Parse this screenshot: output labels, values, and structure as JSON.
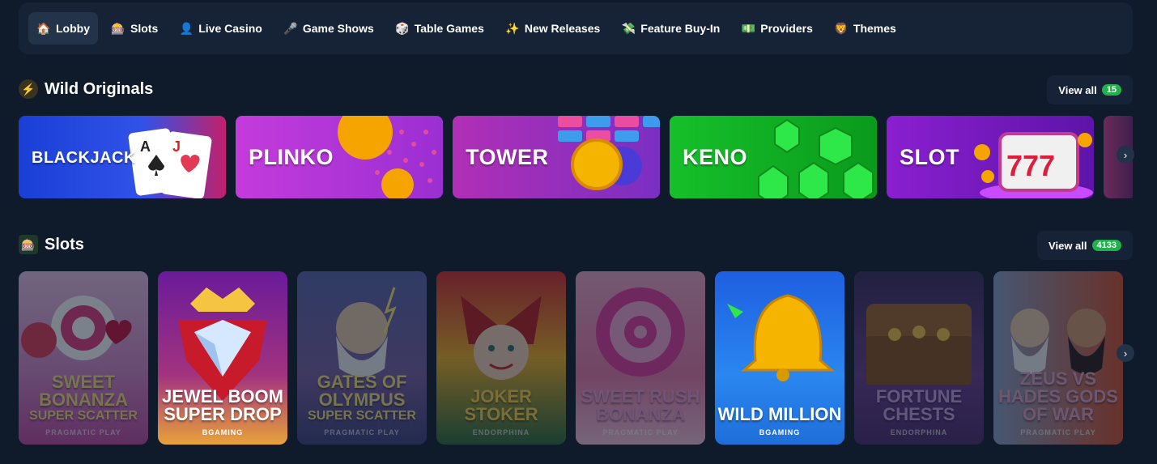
{
  "nav": {
    "items": [
      {
        "label": "Lobby",
        "icon": "house-icon",
        "active": true
      },
      {
        "label": "Slots",
        "icon": "slot-machine-icon"
      },
      {
        "label": "Live Casino",
        "icon": "dealer-icon"
      },
      {
        "label": "Game Shows",
        "icon": "microphone-icon"
      },
      {
        "label": "Table Games",
        "icon": "dice-icon"
      },
      {
        "label": "New Releases",
        "icon": "sparkle-icon"
      },
      {
        "label": "Feature Buy-In",
        "icon": "cash-icon"
      },
      {
        "label": "Providers",
        "icon": "money-icon"
      },
      {
        "label": "Themes",
        "icon": "theme-icon"
      }
    ]
  },
  "originals": {
    "title": "Wild Originals",
    "view_all": "View all",
    "count": "15",
    "games": [
      {
        "label": "BLACKJACK",
        "color": "#1f45d8"
      },
      {
        "label": "PLINKO",
        "color": "#b22fd6"
      },
      {
        "label": "TOWER",
        "color": "#a52fbd"
      },
      {
        "label": "KENO",
        "color": "#10b81d"
      },
      {
        "label": "SLOT",
        "color": "#8b1fd0"
      }
    ]
  },
  "slots": {
    "title": "Slots",
    "view_all": "View all",
    "count": "4133",
    "games": [
      {
        "title": "SWEET BONANZA",
        "sub": "SUPER SCATTER",
        "provider": "PRAGMATIC PLAY"
      },
      {
        "title": "JEWEL BOOM SUPER DROP",
        "sub": "",
        "provider": "BGAMING"
      },
      {
        "title": "GATES OF OLYMPUS",
        "sub": "SUPER SCATTER",
        "provider": "PRAGMATIC PLAY"
      },
      {
        "title": "JOKER STOKER",
        "sub": "",
        "provider": "ENDORPHINA"
      },
      {
        "title": "SWEET RUSH BONANZA",
        "sub": "",
        "provider": "PRAGMATIC PLAY"
      },
      {
        "title": "WILD MILLION",
        "sub": "",
        "provider": "BGAMING"
      },
      {
        "title": "FORTUNE CHESTS",
        "sub": "",
        "provider": "ENDORPHINA"
      },
      {
        "title": "ZEUS VS HADES GODS OF WAR",
        "sub": "",
        "provider": "PRAGMATIC PLAY"
      }
    ]
  }
}
